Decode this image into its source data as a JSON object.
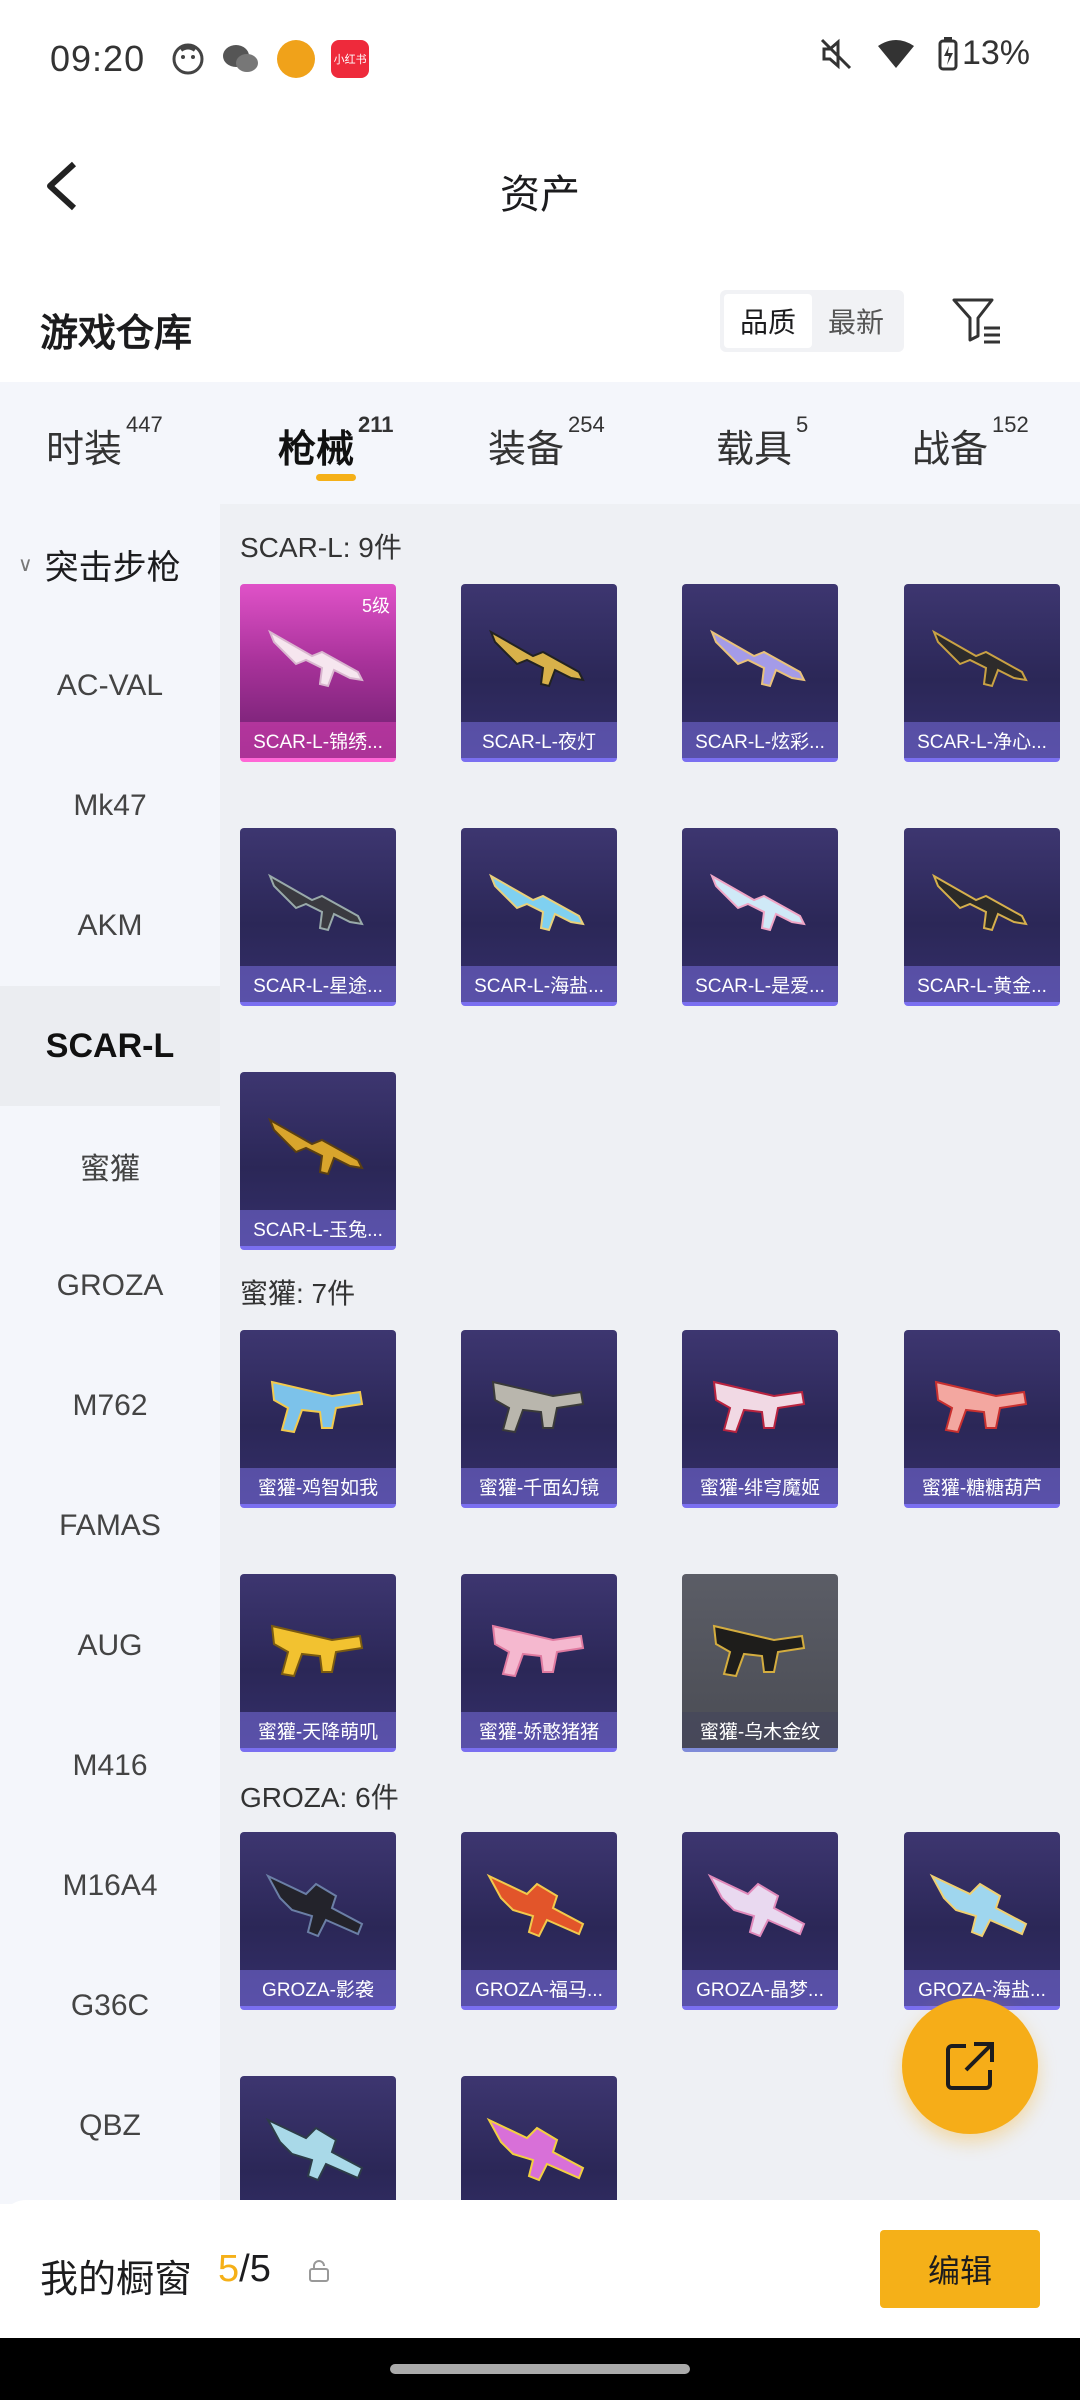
{
  "status_bar": {
    "time": "09:20",
    "battery": "13%",
    "app_badge_text": "小红书"
  },
  "header": {
    "title": "资产"
  },
  "warehouse": {
    "title": "游戏仓库",
    "sort_options": [
      {
        "label": "品质",
        "active": true
      },
      {
        "label": "最新",
        "active": false
      }
    ]
  },
  "category_tabs": [
    {
      "label": "时装",
      "count": "447"
    },
    {
      "label": "枪械",
      "count": "211",
      "active": true
    },
    {
      "label": "装备",
      "count": "254"
    },
    {
      "label": "载具",
      "count": "5"
    },
    {
      "label": "战备",
      "count": "152"
    }
  ],
  "sidebar": {
    "group": "突击步枪",
    "items": [
      "AC-VAL",
      "Mk47",
      "AKM",
      "SCAR-L",
      "蜜獾",
      "GROZA",
      "M762",
      "FAMAS",
      "AUG",
      "M416",
      "M16A4",
      "G36C",
      "QBZ"
    ],
    "selected": "SCAR-L"
  },
  "groups": [
    {
      "title": "SCAR-L: 9件",
      "items": [
        {
          "label": "SCAR-L-锦绣...",
          "level": "5级",
          "style": "pink"
        },
        {
          "label": "SCAR-L-夜灯"
        },
        {
          "label": "SCAR-L-炫彩..."
        },
        {
          "label": "SCAR-L-净心..."
        },
        {
          "label": "SCAR-L-星途..."
        },
        {
          "label": "SCAR-L-海盐..."
        },
        {
          "label": "SCAR-L-是爱..."
        },
        {
          "label": "SCAR-L-黄金..."
        },
        {
          "label": "SCAR-L-玉兔..."
        }
      ]
    },
    {
      "title": "蜜獾: 7件",
      "items": [
        {
          "label": "蜜獾-鸡智如我"
        },
        {
          "label": "蜜獾-千面幻镜"
        },
        {
          "label": "蜜獾-绯穹魔姬"
        },
        {
          "label": "蜜獾-糖糖葫芦"
        },
        {
          "label": "蜜獾-天降萌叽"
        },
        {
          "label": "蜜獾-娇憨猪猪"
        },
        {
          "label": "蜜獾-乌木金纹",
          "style": "grey"
        }
      ]
    },
    {
      "title": "GROZA: 6件",
      "items": [
        {
          "label": "GROZA-影袭"
        },
        {
          "label": "GROZA-福马..."
        },
        {
          "label": "GROZA-晶梦..."
        },
        {
          "label": "GROZA-海盐..."
        },
        {
          "label": ""
        },
        {
          "label": ""
        }
      ]
    }
  ],
  "showcase": {
    "label": "我的橱窗",
    "current": "5",
    "total": "/5",
    "edit_label": "编辑"
  },
  "colors": {
    "accent": "#f5b018",
    "card_bg": "#2b2757",
    "card_legendary": "#e052c8",
    "sidebar_bg": "#f4f6fb"
  }
}
